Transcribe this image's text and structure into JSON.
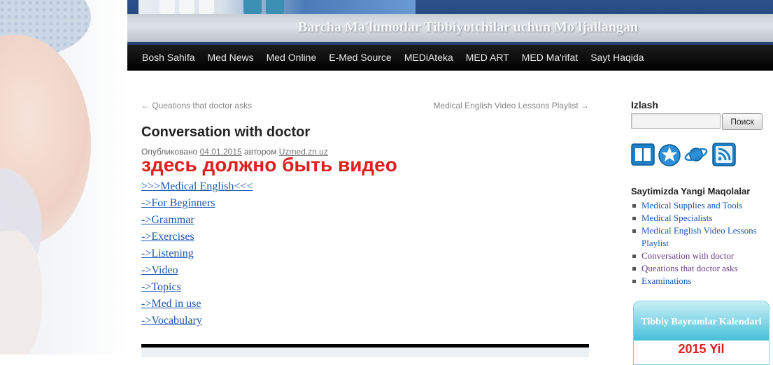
{
  "header": {
    "banner_text": "Barcha Ma'lumotlar Tibbiyotchilar uchun Mo'ljallangan"
  },
  "nav": {
    "items": [
      "Bosh Sahifa",
      "Med News",
      "Med Online",
      "E-Med Source",
      "MEDiAteka",
      "MED ART",
      "MED Ma'rifat",
      "Sayt Haqida"
    ]
  },
  "post": {
    "prev_link": "← Queations that doctor asks",
    "next_link": "Medical English Video Lessons Playlist →",
    "title": "Conversation with doctor",
    "meta_published": "Опубликовано",
    "meta_date": "04.01.2015",
    "meta_author_label": "автором",
    "meta_author": "Uzmed.zn.uz",
    "video_note": "здесь должно быть видео",
    "links": [
      ">>>Medical English<<<",
      "->For Beginners",
      "->Grammar",
      "->Exercises",
      "->Listening",
      "->Video",
      "->Topics",
      "->Med in use",
      "->Vocabulary"
    ]
  },
  "sidebar": {
    "search_title": "Izlash",
    "search_placeholder": "",
    "search_button": "Поиск",
    "icons": [
      "book-icon",
      "star-globe-icon",
      "planet-icon",
      "rss-icon"
    ],
    "recent_heading": "Saytimizda Yangi Maqolalar",
    "recent": [
      {
        "label": "Medical Supplies and Tools",
        "color": "#1b57b1"
      },
      {
        "label": "Medical Specialists",
        "color": "#1b57b1"
      },
      {
        "label": "Medical English Video Lessons Playlist",
        "color": "#1b57b1"
      },
      {
        "label": "Conversation with doctor",
        "color": "#6a3a8a"
      },
      {
        "label": "Queations that doctor asks",
        "color": "#6a3a8a"
      },
      {
        "label": "Examinations",
        "color": "#1b57b1"
      }
    ],
    "calendar_title": "Tibbiy Bayramlar Kalendari",
    "calendar_year": "2015 Yil"
  },
  "colors": {
    "nav_bg": "#000000",
    "link": "#1b57b1",
    "visited": "#6a3a8a",
    "alert": "#e02020",
    "calendar_accent": "#45bfd8"
  }
}
